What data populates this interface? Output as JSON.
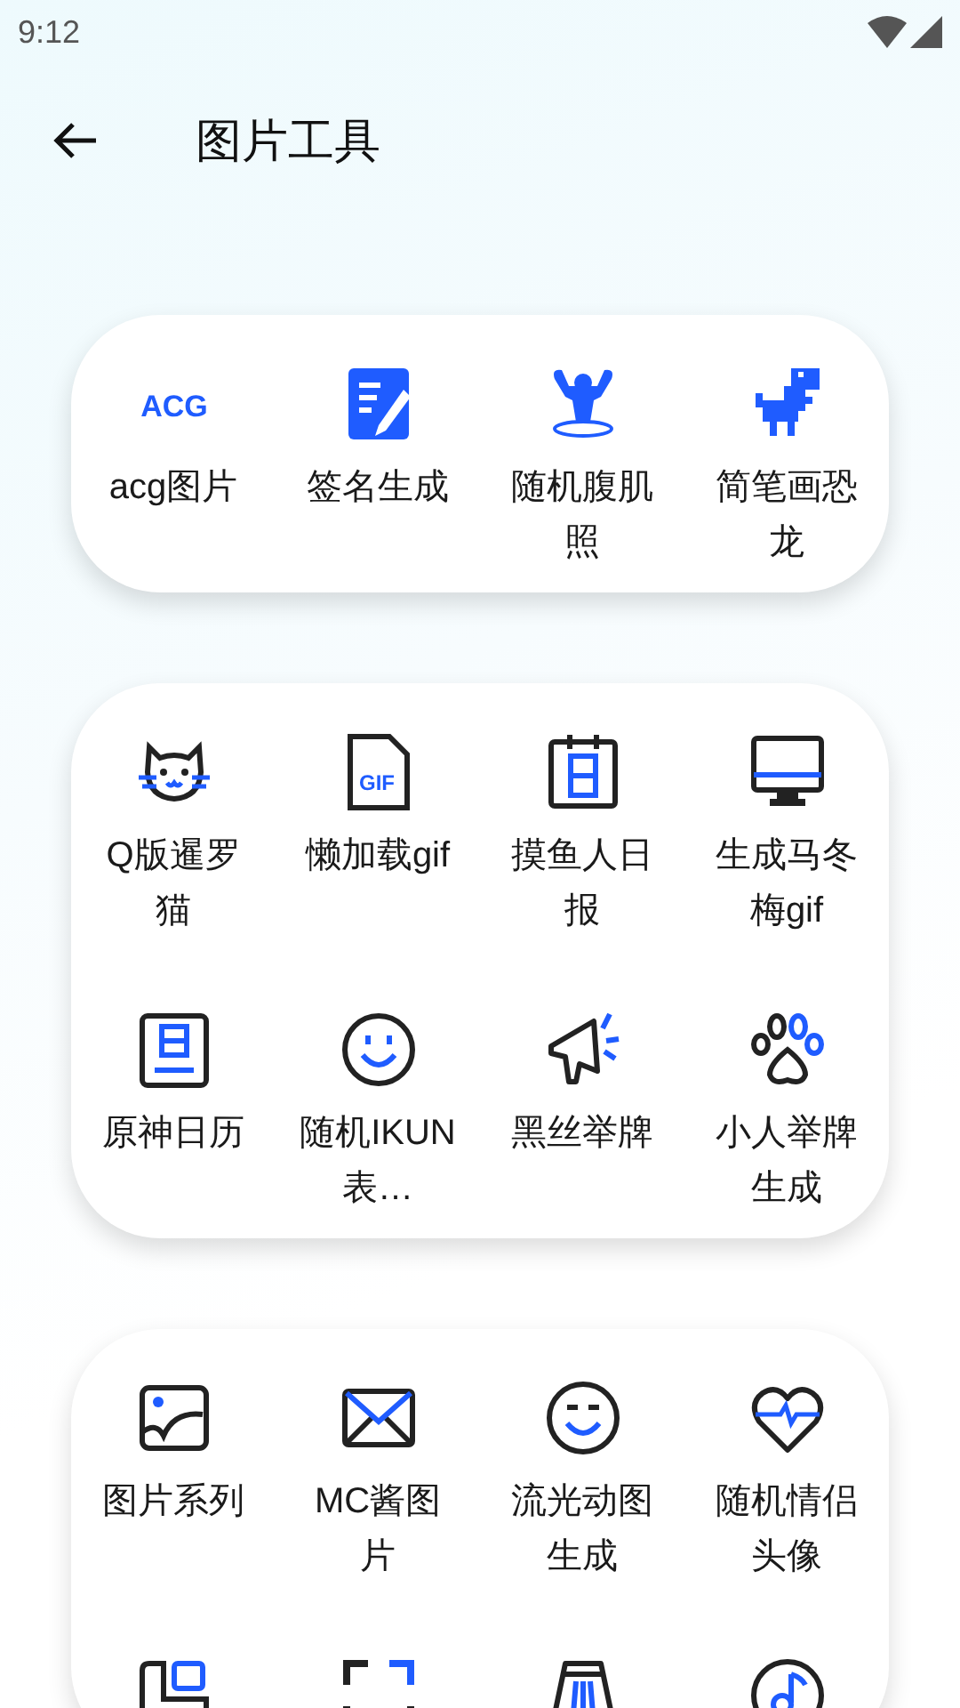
{
  "status_bar": {
    "time": "9:12"
  },
  "header": {
    "title": "图片工具"
  },
  "cards": [
    {
      "items": [
        {
          "kind": "tool",
          "label": "acg图片",
          "icon_text": "ACG"
        },
        {
          "kind": "tool",
          "label": "签名生成"
        },
        {
          "kind": "tool",
          "label": "随机腹肌照"
        },
        {
          "kind": "tool",
          "label": "简笔画恐龙"
        }
      ]
    },
    {
      "items": [
        {
          "kind": "tool",
          "label": "Q版暹罗猫"
        },
        {
          "kind": "tool",
          "label": "懒加载gif",
          "icon_text": "GIF"
        },
        {
          "kind": "tool",
          "label": "摸鱼人日报"
        },
        {
          "kind": "tool",
          "label": "生成马冬梅gif"
        },
        {
          "kind": "tool",
          "label": "原神日历"
        },
        {
          "kind": "tool",
          "label": "随机IKUN表…"
        },
        {
          "kind": "tool",
          "label": "黑丝举牌"
        },
        {
          "kind": "tool",
          "label": "小人举牌生成"
        }
      ]
    },
    {
      "items": [
        {
          "kind": "tool",
          "label": "图片系列"
        },
        {
          "kind": "tool",
          "label": "MC酱图片"
        },
        {
          "kind": "tool",
          "label": "流光动图生成"
        },
        {
          "kind": "tool",
          "label": "随机情侣头像"
        },
        {
          "kind": "icon_only"
        },
        {
          "kind": "icon_only"
        },
        {
          "kind": "icon_only"
        },
        {
          "kind": "icon_only"
        }
      ]
    }
  ]
}
